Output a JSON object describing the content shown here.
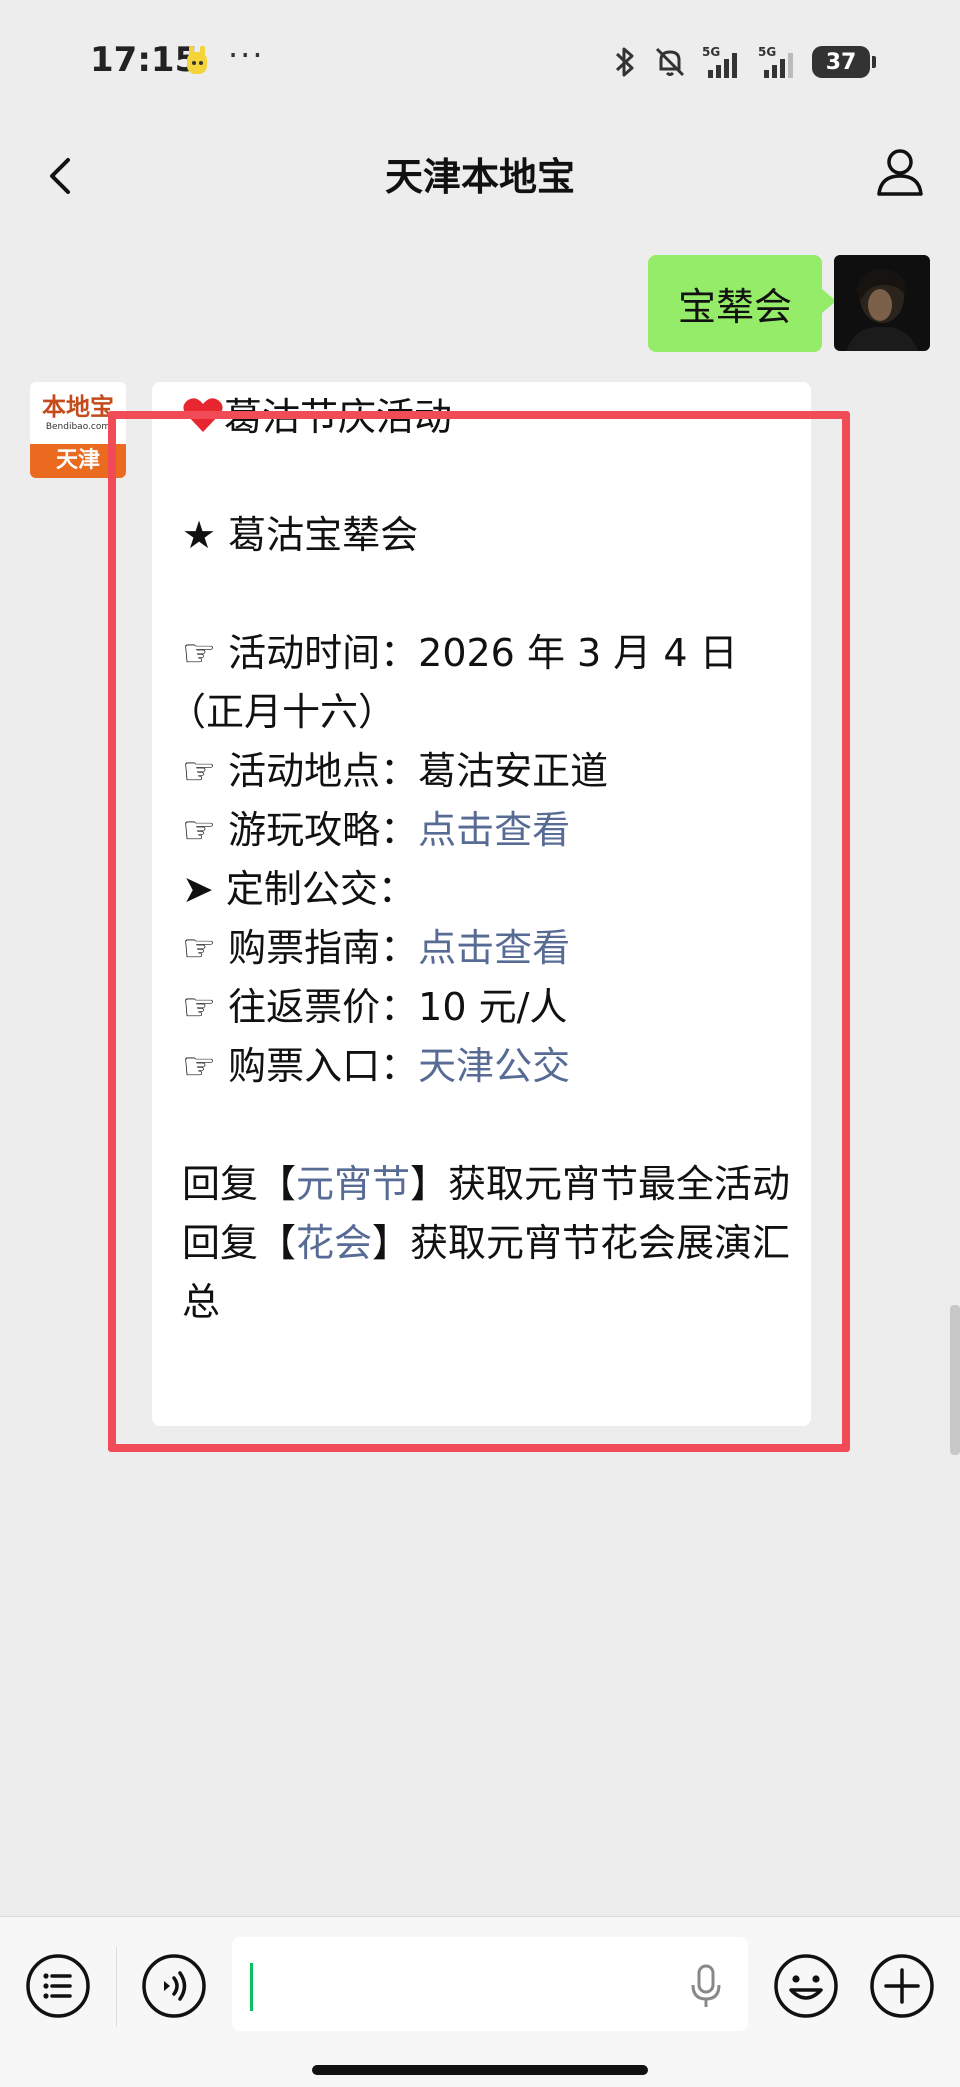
{
  "status": {
    "time": "17:15",
    "dots": "···",
    "battery": "37",
    "net1": "5G",
    "net2": "5G"
  },
  "nav": {
    "title": "天津本地宝"
  },
  "outgoing": {
    "text": "宝辇会"
  },
  "bot_avatar": {
    "logo_text": "本地宝",
    "logo_url": "Bendibao.com",
    "city": "天津"
  },
  "incoming": {
    "heading": "葛沽节庆活动",
    "subheading": "★ 葛沽宝辇会",
    "time_label": "☞ 活动时间：",
    "time_value": "2026 年 3 月 4 日",
    "time_note": "（正月十六）",
    "place_label": "☞ 活动地点：",
    "place_value": "葛沽安正道",
    "guide_label": "☞ 游玩攻略：",
    "guide_link": "点击查看",
    "bus_label": "➤ 定制公交：",
    "ticket_guide_label": "☞ 购票指南：",
    "ticket_guide_link": "点击查看",
    "price_label": "☞ 往返票价：",
    "price_value": "10 元/人",
    "buy_label": "☞ 购票入口：",
    "buy_link": "天津公交",
    "reply1_pre": "回复【",
    "reply1_kw": "元宵节",
    "reply1_post": "】获取元宵节最全活动",
    "reply2_pre": "回复【",
    "reply2_kw": "花会",
    "reply2_post": "】获取元宵节花会展演汇总"
  },
  "colors": {
    "accent_green": "#95ec69",
    "link": "#576b95",
    "highlight": "#f04b56",
    "heart": "#e8262f"
  }
}
